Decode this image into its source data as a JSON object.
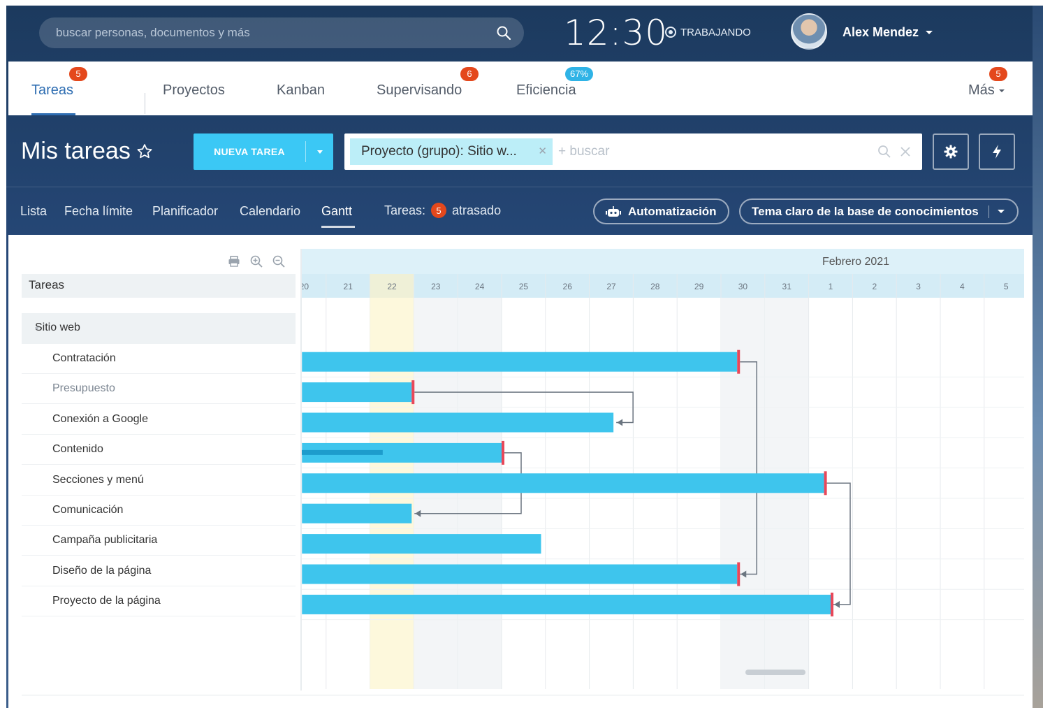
{
  "topbar": {
    "search_placeholder": "buscar personas, documentos y más",
    "clock": "12:30",
    "status": "TRABAJANDO",
    "user_name": "Alex Mendez"
  },
  "nav": {
    "tabs": [
      {
        "label": "Tareas",
        "badge": "5",
        "badge_color": "#e4481c",
        "active": true
      },
      {
        "label": "Proyectos"
      },
      {
        "label": "Kanban"
      },
      {
        "label": "Supervisando",
        "badge": "6",
        "badge_color": "#e4481c"
      },
      {
        "label": "Eficiencia",
        "badge": "67%",
        "badge_color": "#2fb3e6"
      }
    ],
    "more": {
      "label": "Más",
      "badge": "5"
    }
  },
  "title_bar": {
    "title": "Mis tareas",
    "new_task_label": "NUEVA TAREA",
    "filter_chip": "Proyecto (grupo): Sitio w...",
    "filter_search_placeholder": "+ buscar"
  },
  "view_bar": {
    "tabs": [
      "Lista",
      "Fecha límite",
      "Planificador",
      "Calendario",
      "Gantt"
    ],
    "active_tab": "Gantt",
    "overdue_prefix": "Tareas:",
    "overdue_count": "5",
    "overdue_suffix": "atrasado",
    "automation_label": "Automatización",
    "theme_label": "Tema claro de la base de conocimientos"
  },
  "gantt": {
    "column_header": "Tareas",
    "month_label": "Febrero 2021",
    "days": [
      "20",
      "21",
      "22",
      "23",
      "24",
      "25",
      "26",
      "27",
      "28",
      "29",
      "30",
      "31",
      "1",
      "2",
      "3",
      "4",
      "5"
    ],
    "today_index": 2,
    "group": "Sitio web",
    "tasks": [
      {
        "name": "Contratación",
        "start": 0,
        "end": 9.92,
        "deadline": true
      },
      {
        "name": "Presupuesto",
        "start": 0,
        "end": 2.5,
        "deadline": true,
        "muted": true
      },
      {
        "name": "Conexión a Google",
        "start": 0,
        "end": 7.1,
        "deadline": false
      },
      {
        "name": "Contenido",
        "start": 0,
        "end": 4.55,
        "deadline": true,
        "progress": 0.45
      },
      {
        "name": "Secciones y menú",
        "start": 0,
        "end": 11.9,
        "deadline": true
      },
      {
        "name": "Comunicación",
        "start": 0,
        "end": 2.5,
        "deadline": false
      },
      {
        "name": "Campaña publicitaria",
        "start": 0,
        "end": 5.45,
        "deadline": false
      },
      {
        "name": "Diseño de la página",
        "start": 0,
        "end": 9.92,
        "deadline": true
      },
      {
        "name": "Proyecto de la página",
        "start": 0,
        "end": 12.05,
        "deadline": true
      }
    ],
    "dependencies": [
      {
        "from": 1,
        "to": 2
      },
      {
        "from": 3,
        "to": 5
      },
      {
        "from": 0,
        "to": 7
      },
      {
        "from": 4,
        "to": 8
      }
    ]
  },
  "colors": {
    "bar": "#3ec5ed",
    "deadline": "#e8485a",
    "header_band": "#ddf1f9",
    "today": "#fdf8dc"
  }
}
